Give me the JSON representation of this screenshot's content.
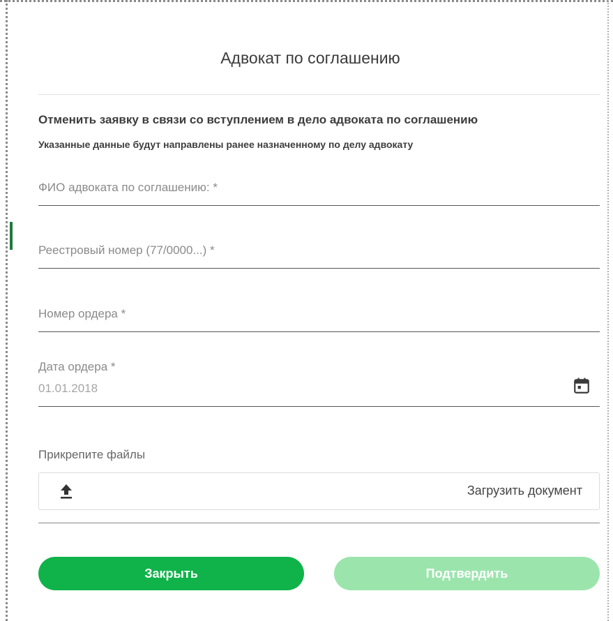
{
  "dialog": {
    "title": "Адвокат по соглашению",
    "subtitle": "Отменить заявку в связи со вступлением в дело адвоката по соглашению",
    "note": "Указанные данные будут направлены ранее назначенному по делу адвокату"
  },
  "fields": {
    "lawyer_name": {
      "placeholder": "ФИО адвоката по соглашению: *",
      "value": ""
    },
    "registry_number": {
      "placeholder": "Реестровый номер (77/0000...) *",
      "value": ""
    },
    "order_number": {
      "placeholder": "Номер ордера *",
      "value": ""
    },
    "order_date": {
      "label": "Дата ордера *",
      "value": "01.01.2018",
      "icon": "calendar-icon"
    }
  },
  "attachments": {
    "label": "Прикрепите файлы",
    "upload_label": "Загрузить документ",
    "icon": "upload-icon"
  },
  "buttons": {
    "close_label": "Закрыть",
    "confirm_label": "Подтвердить"
  },
  "colors": {
    "primary": "#0fb34a",
    "primary_disabled": "#9be5ad",
    "text": "#3b3b3b",
    "placeholder": "#8a8a8a"
  }
}
